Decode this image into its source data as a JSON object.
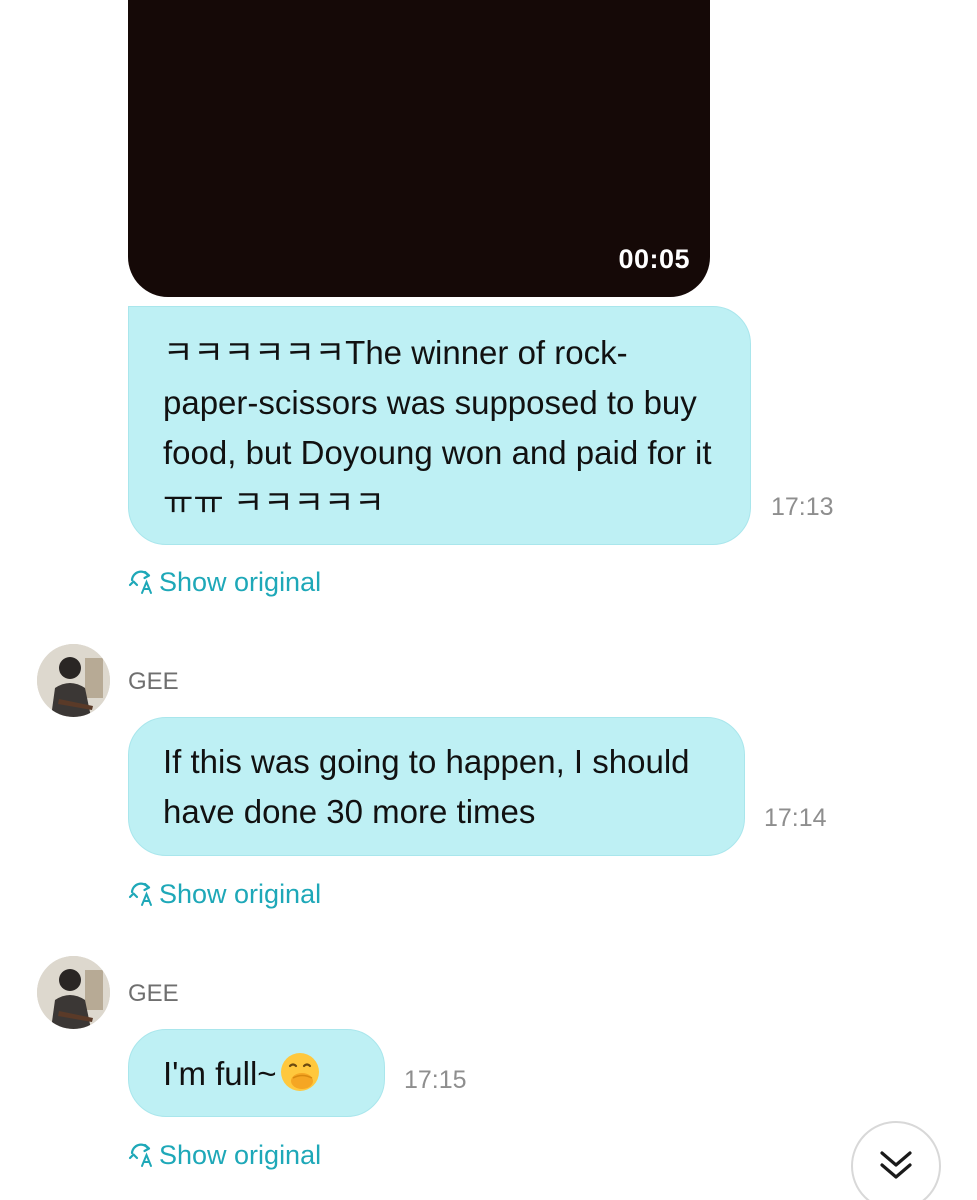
{
  "video": {
    "duration": "00:05"
  },
  "messages": [
    {
      "text": "ㅋㅋㅋㅋㅋㅋThe winner of rock-paper-scissors was supposed to buy food, but Doyoung won and paid for it ㅠㅠ ㅋㅋㅋㅋㅋ",
      "time": "17:13",
      "show_original": "Show original"
    },
    {
      "sender": "GEE",
      "text": "If this was going to happen, I should have done 30 more times",
      "time": "17:14",
      "show_original": "Show original"
    },
    {
      "sender": "GEE",
      "text": "I'm full~",
      "emoji": "hand-over-mouth-emoji",
      "time": "17:15",
      "show_original": "Show original"
    }
  ],
  "icons": {
    "translate": "translate-icon",
    "scroll_down": "double-chevron-down-icon"
  },
  "colors": {
    "bubble": "#bef0f4",
    "link": "#1ea8b8",
    "timestamp": "#8e8e8e"
  }
}
